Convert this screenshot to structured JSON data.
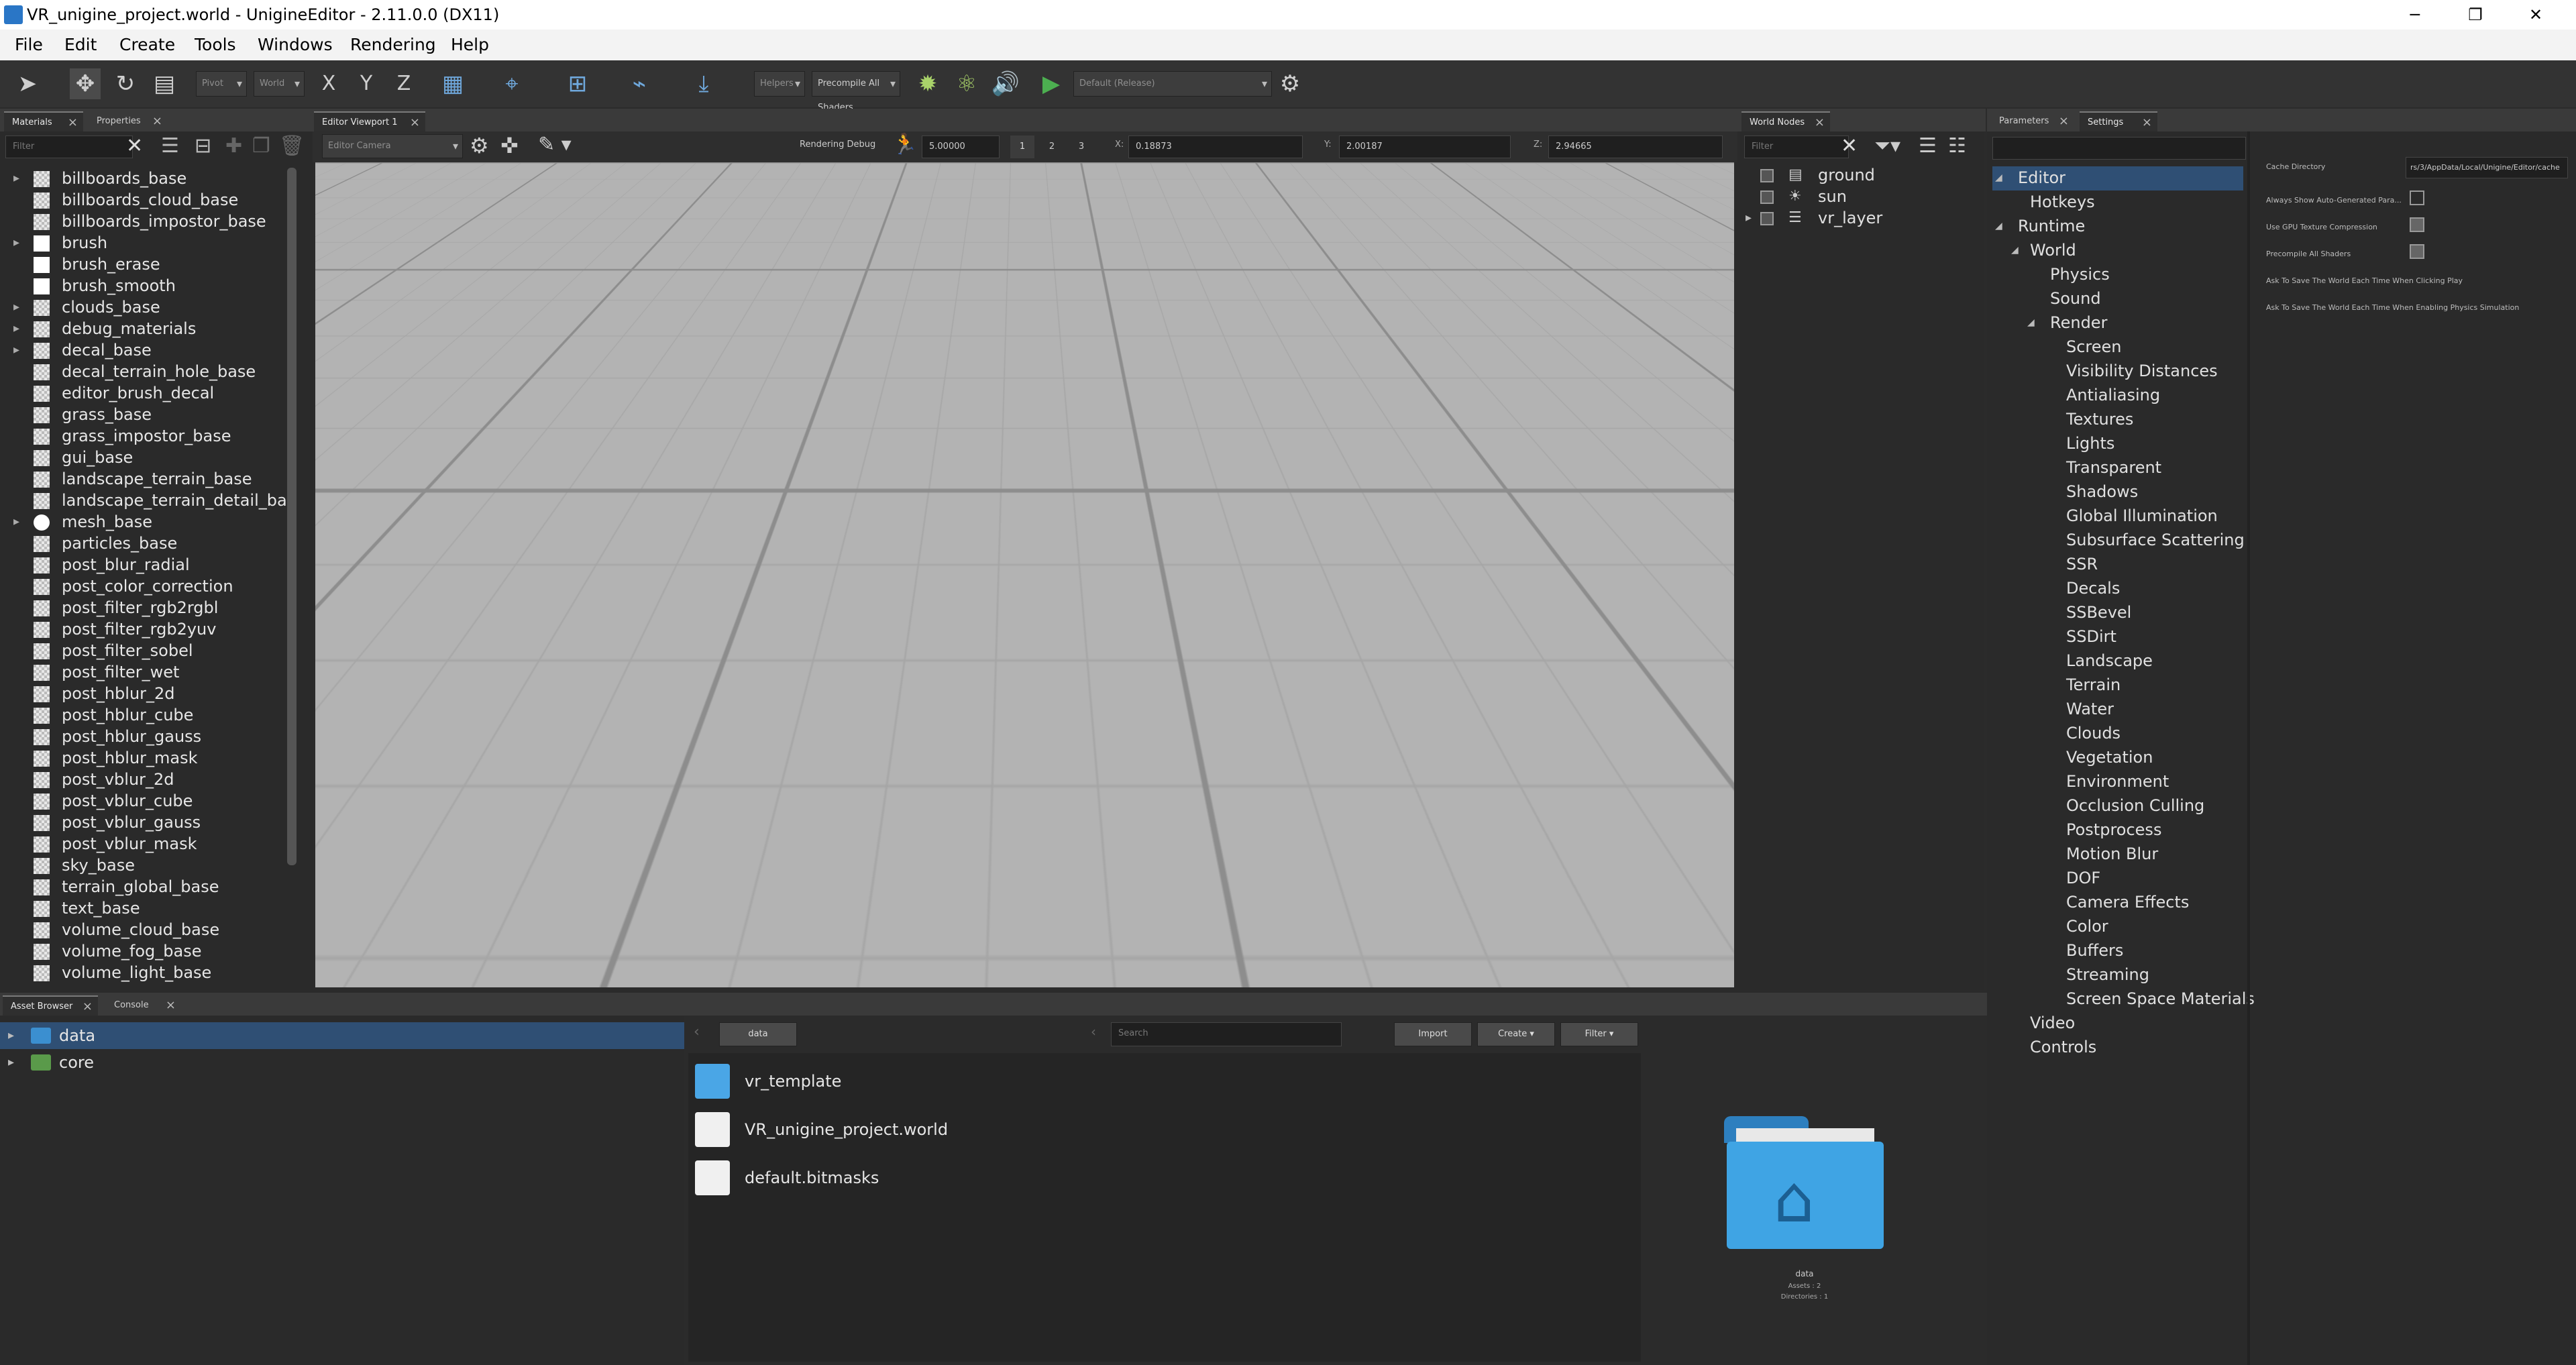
{
  "window": {
    "title": "VR_unigine_project.world - UnigineEditor - 2.11.0.0 (DX11)",
    "minimize": "─",
    "maximize": "❐",
    "close": "✕"
  },
  "menu": [
    "File",
    "Edit",
    "Create",
    "Tools",
    "Windows",
    "Rendering",
    "Help"
  ],
  "toolbar": {
    "pivot": "Pivot",
    "space": "World",
    "helpers": "Helpers",
    "precompile": "Precompile All Shaders",
    "axis_x": "X",
    "axis_y": "Y",
    "axis_z": "Z",
    "play_preset": "Default (Release)"
  },
  "materials_panel": {
    "tabs": [
      "Materials",
      "Properties"
    ],
    "filter_placeholder": "Filter",
    "items": [
      {
        "name": "billboards_base",
        "arrow": "▸",
        "sw": "checker"
      },
      {
        "name": "billboards_cloud_base",
        "arrow": "",
        "sw": "checker"
      },
      {
        "name": "billboards_impostor_base",
        "arrow": "",
        "sw": "checker"
      },
      {
        "name": "brush",
        "arrow": "▸",
        "sw": "white"
      },
      {
        "name": "brush_erase",
        "arrow": "",
        "sw": "white"
      },
      {
        "name": "brush_smooth",
        "arrow": "",
        "sw": "white"
      },
      {
        "name": "clouds_base",
        "arrow": "▸",
        "sw": "checker"
      },
      {
        "name": "debug_materials",
        "arrow": "▸",
        "sw": "checker"
      },
      {
        "name": "decal_base",
        "arrow": "▸",
        "sw": "checker"
      },
      {
        "name": "decal_terrain_hole_base",
        "arrow": "",
        "sw": "checker"
      },
      {
        "name": "editor_brush_decal",
        "arrow": "",
        "sw": "checker"
      },
      {
        "name": "grass_base",
        "arrow": "",
        "sw": "checker"
      },
      {
        "name": "grass_impostor_base",
        "arrow": "",
        "sw": "checker"
      },
      {
        "name": "gui_base",
        "arrow": "",
        "sw": "checker"
      },
      {
        "name": "landscape_terrain_base",
        "arrow": "",
        "sw": "checker"
      },
      {
        "name": "landscape_terrain_detail_base",
        "arrow": "",
        "sw": "checker"
      },
      {
        "name": "mesh_base",
        "arrow": "▸",
        "sw": "round"
      },
      {
        "name": "particles_base",
        "arrow": "",
        "sw": "checker"
      },
      {
        "name": "post_blur_radial",
        "arrow": "",
        "sw": "checker"
      },
      {
        "name": "post_color_correction",
        "arrow": "",
        "sw": "checker"
      },
      {
        "name": "post_filter_rgb2rgbl",
        "arrow": "",
        "sw": "checker"
      },
      {
        "name": "post_filter_rgb2yuv",
        "arrow": "",
        "sw": "checker"
      },
      {
        "name": "post_filter_sobel",
        "arrow": "",
        "sw": "checker"
      },
      {
        "name": "post_filter_wet",
        "arrow": "",
        "sw": "checker"
      },
      {
        "name": "post_hblur_2d",
        "arrow": "",
        "sw": "checker"
      },
      {
        "name": "post_hblur_cube",
        "arrow": "",
        "sw": "checker"
      },
      {
        "name": "post_hblur_gauss",
        "arrow": "",
        "sw": "checker"
      },
      {
        "name": "post_hblur_mask",
        "arrow": "",
        "sw": "checker"
      },
      {
        "name": "post_vblur_2d",
        "arrow": "",
        "sw": "checker"
      },
      {
        "name": "post_vblur_cube",
        "arrow": "",
        "sw": "checker"
      },
      {
        "name": "post_vblur_gauss",
        "arrow": "",
        "sw": "checker"
      },
      {
        "name": "post_vblur_mask",
        "arrow": "",
        "sw": "checker"
      },
      {
        "name": "sky_base",
        "arrow": "",
        "sw": "checker"
      },
      {
        "name": "terrain_global_base",
        "arrow": "",
        "sw": "checker"
      },
      {
        "name": "text_base",
        "arrow": "",
        "sw": "checker"
      },
      {
        "name": "volume_cloud_base",
        "arrow": "",
        "sw": "checker"
      },
      {
        "name": "volume_fog_base",
        "arrow": "",
        "sw": "checker"
      },
      {
        "name": "volume_light_base",
        "arrow": "",
        "sw": "checker"
      }
    ]
  },
  "viewport": {
    "tab": "Editor Viewport 1",
    "camera": "Editor Camera",
    "rendering_debug": "Rendering Debug",
    "speed": "5.00000",
    "speed_steps": [
      "1",
      "2",
      "3"
    ],
    "x_label": "X:",
    "x": "0.18873",
    "y_label": "Y:",
    "y": "2.00187",
    "z_label": "Z:",
    "z": "2.94665",
    "gizmo_z": "Z",
    "gizmo_y": "Y"
  },
  "world_nodes": {
    "tab": "World Nodes",
    "filter_placeholder": "Filter",
    "nodes": [
      {
        "name": "ground",
        "arrow": ""
      },
      {
        "name": "sun",
        "arrow": ""
      },
      {
        "name": "vr_layer",
        "arrow": "▸"
      }
    ]
  },
  "settings_panel": {
    "tabs": [
      "Parameters",
      "Settings"
    ],
    "tree": [
      {
        "label": "Editor",
        "depth": 0,
        "arrow": "◢",
        "selected": true
      },
      {
        "label": "Hotkeys",
        "depth": 1,
        "arrow": ""
      },
      {
        "label": "Runtime",
        "depth": 0,
        "arrow": "◢"
      },
      {
        "label": "World",
        "depth": 1,
        "arrow": "◢"
      },
      {
        "label": "Physics",
        "depth": 2,
        "arrow": ""
      },
      {
        "label": "Sound",
        "depth": 2,
        "arrow": ""
      },
      {
        "label": "Render",
        "depth": 2,
        "arrow": "◢"
      },
      {
        "label": "Screen",
        "depth": 3,
        "arrow": ""
      },
      {
        "label": "Visibility Distances",
        "depth": 3,
        "arrow": ""
      },
      {
        "label": "Antialiasing",
        "depth": 3,
        "arrow": ""
      },
      {
        "label": "Textures",
        "depth": 3,
        "arrow": ""
      },
      {
        "label": "Lights",
        "depth": 3,
        "arrow": ""
      },
      {
        "label": "Transparent",
        "depth": 3,
        "arrow": ""
      },
      {
        "label": "Shadows",
        "depth": 3,
        "arrow": ""
      },
      {
        "label": "Global Illumination",
        "depth": 3,
        "arrow": ""
      },
      {
        "label": "Subsurface Scattering",
        "depth": 3,
        "arrow": ""
      },
      {
        "label": "SSR",
        "depth": 3,
        "arrow": ""
      },
      {
        "label": "Decals",
        "depth": 3,
        "arrow": ""
      },
      {
        "label": "SSBevel",
        "depth": 3,
        "arrow": ""
      },
      {
        "label": "SSDirt",
        "depth": 3,
        "arrow": ""
      },
      {
        "label": "Landscape",
        "depth": 3,
        "arrow": ""
      },
      {
        "label": "Terrain",
        "depth": 3,
        "arrow": ""
      },
      {
        "label": "Water",
        "depth": 3,
        "arrow": ""
      },
      {
        "label": "Clouds",
        "depth": 3,
        "arrow": ""
      },
      {
        "label": "Vegetation",
        "depth": 3,
        "arrow": ""
      },
      {
        "label": "Environment",
        "depth": 3,
        "arrow": ""
      },
      {
        "label": "Occlusion Culling",
        "depth": 3,
        "arrow": ""
      },
      {
        "label": "Postprocess",
        "depth": 3,
        "arrow": ""
      },
      {
        "label": "Motion Blur",
        "depth": 3,
        "arrow": ""
      },
      {
        "label": "DOF",
        "depth": 3,
        "arrow": ""
      },
      {
        "label": "Camera Effects",
        "depth": 3,
        "arrow": ""
      },
      {
        "label": "Color",
        "depth": 3,
        "arrow": ""
      },
      {
        "label": "Buffers",
        "depth": 3,
        "arrow": ""
      },
      {
        "label": "Streaming",
        "depth": 3,
        "arrow": ""
      },
      {
        "label": "Screen Space Materials",
        "depth": 3,
        "arrow": ""
      },
      {
        "label": "Video",
        "depth": 1,
        "arrow": ""
      },
      {
        "label": "Controls",
        "depth": 1,
        "arrow": ""
      }
    ],
    "options": {
      "cache_directory_label": "Cache Directory",
      "cache_directory_value": "rs/3/AppData/Local/Unigine/Editor/cache",
      "always_show": "Always Show Auto-Generated Para...",
      "gpu_compression": "Use GPU Texture Compression",
      "precompile": "Precompile All Shaders",
      "ask_play": "Ask To Save The World Each Time When Clicking Play",
      "ask_physics": "Ask To Save The World Each Time When Enabling Physics Simulation"
    }
  },
  "asset_browser": {
    "tabs": [
      "Asset Browser",
      "Console"
    ],
    "tree": [
      {
        "name": "data",
        "selected": true
      },
      {
        "name": "core",
        "selected": false
      }
    ],
    "path": "data",
    "search_placeholder": "Search",
    "import": "Import",
    "create": "Create",
    "filter": "Filter",
    "files": [
      "vr_template",
      "VR_unigine_project.world",
      "default.bitmasks"
    ],
    "preview": {
      "name": "data",
      "assets": "Assets : 2",
      "directories": "Directories : 1"
    }
  },
  "colors": {
    "selection": "#2f4f74",
    "accent_blue": "#4a90d9",
    "play_green": "#4caf50"
  }
}
